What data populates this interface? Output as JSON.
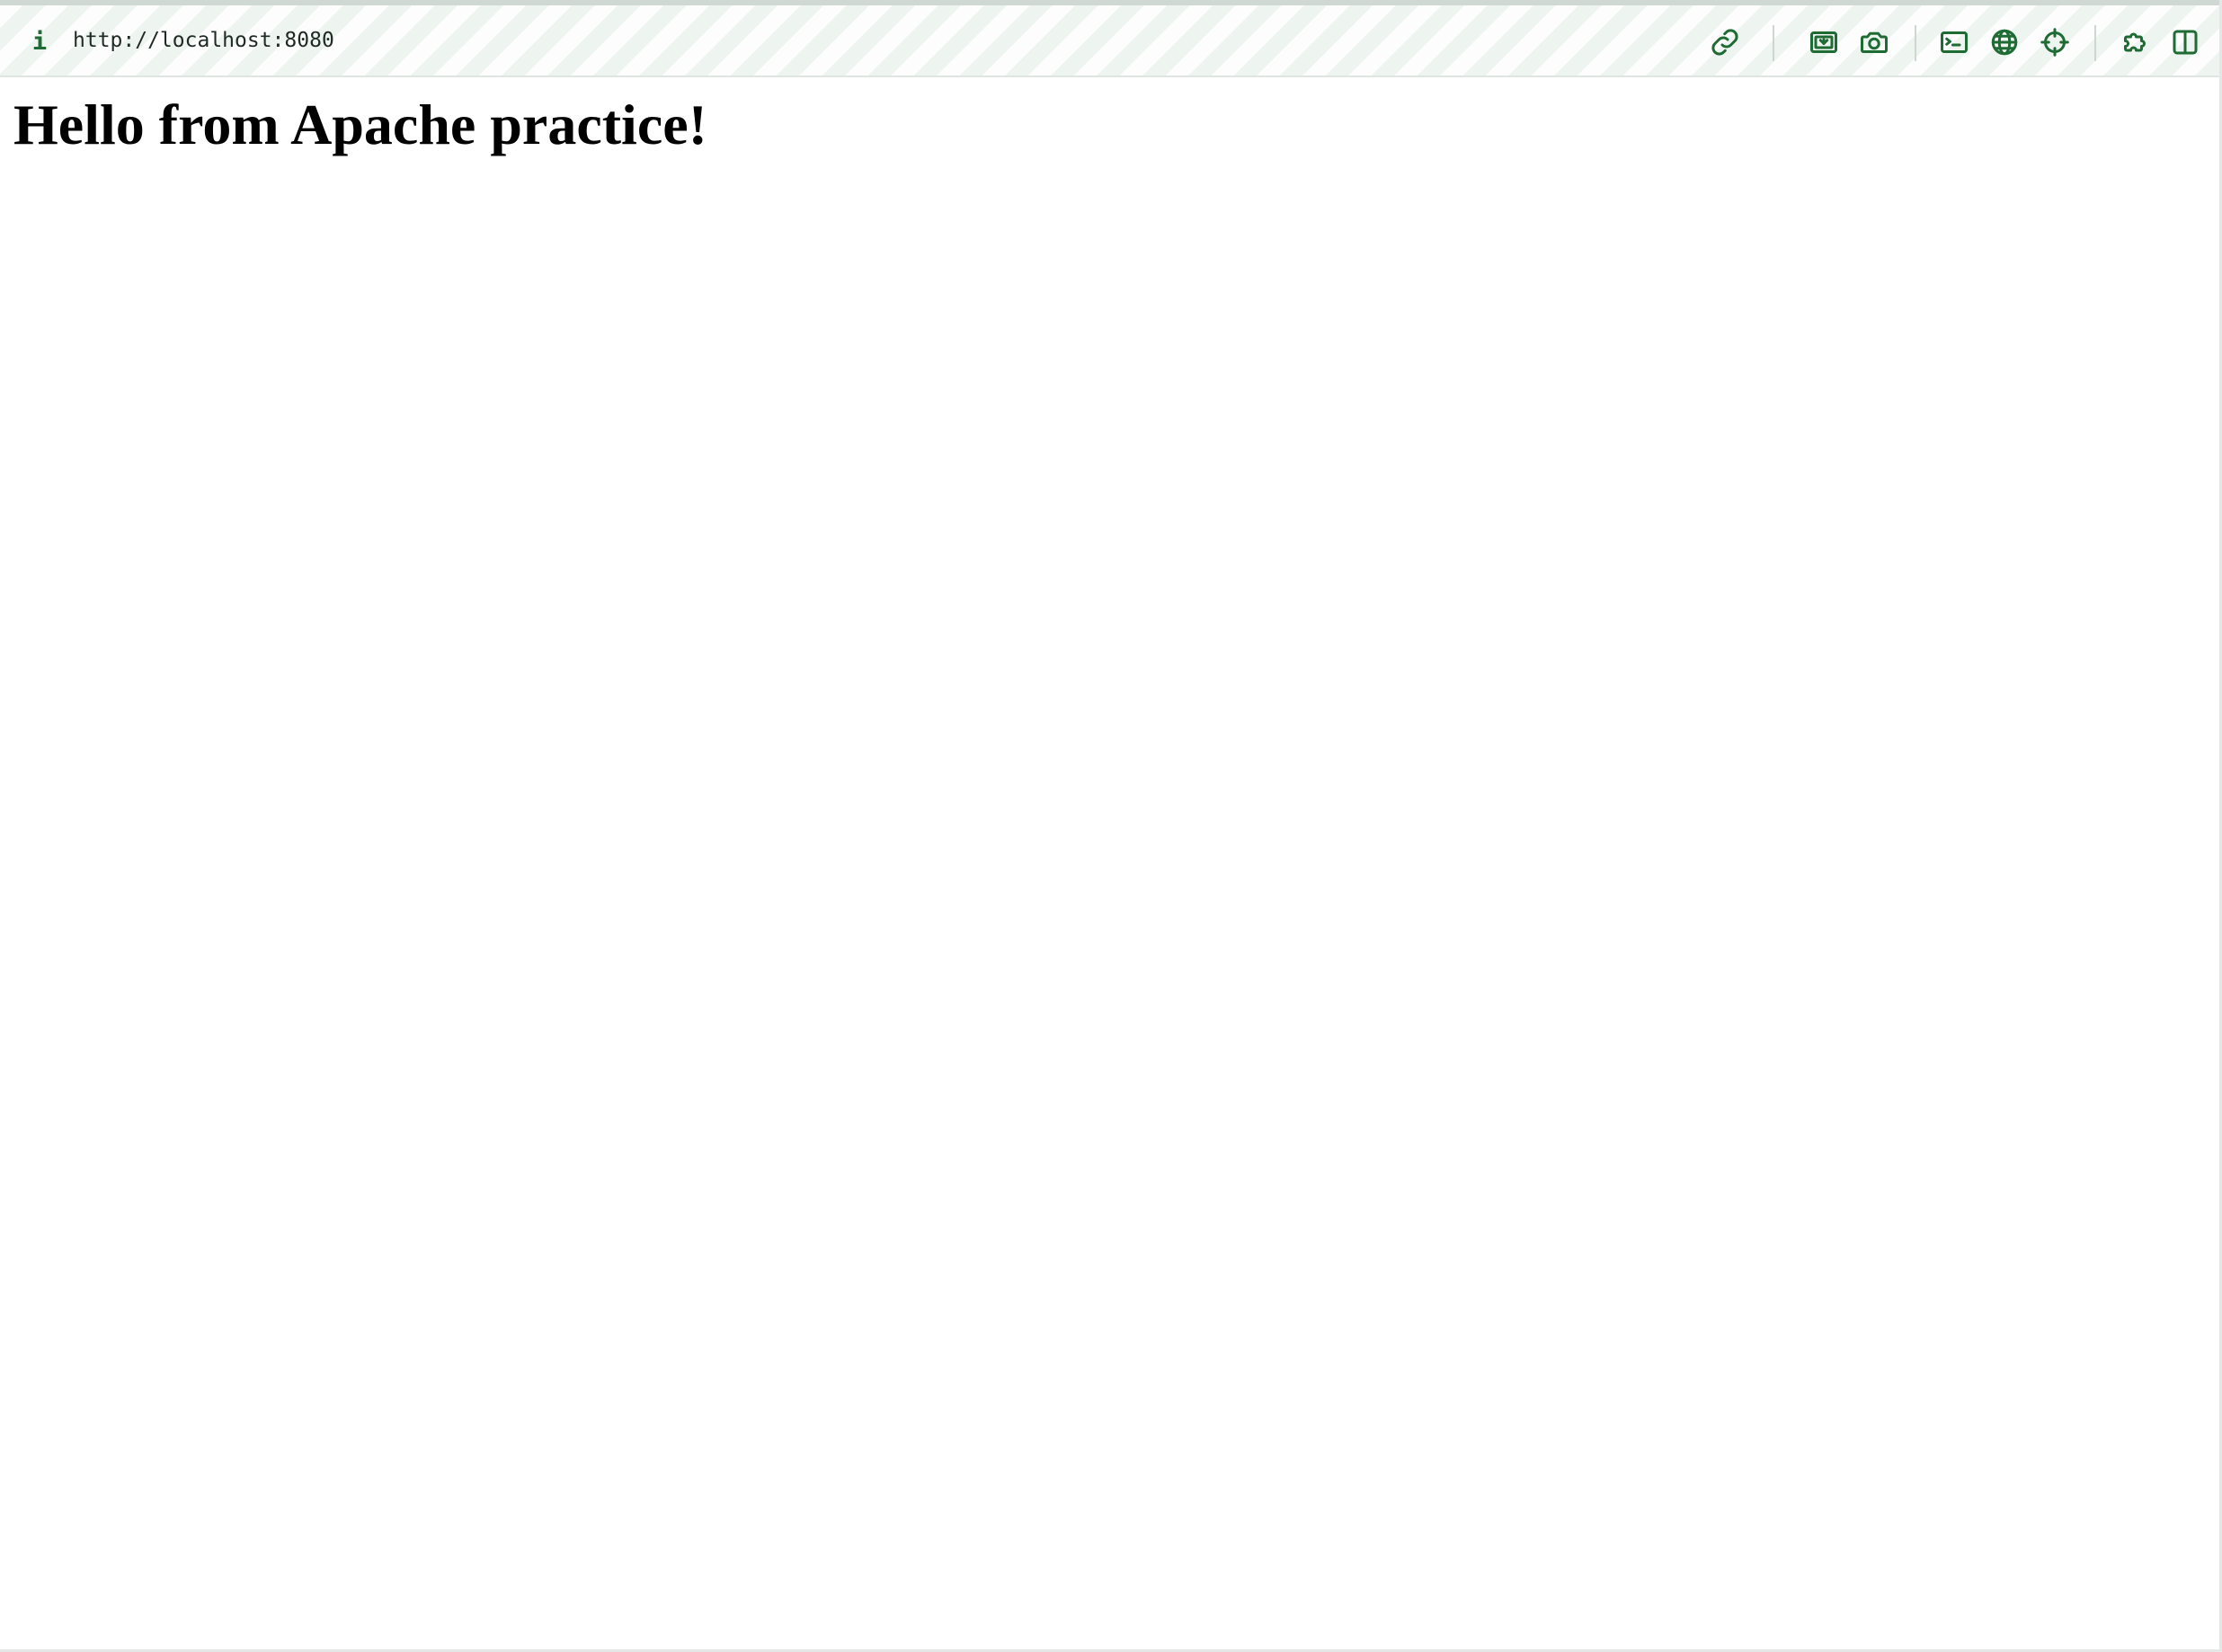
{
  "address_bar": {
    "info_icon": "info-icon",
    "info_glyph": "i",
    "url": "http://localhost:8080"
  },
  "toolbar": {
    "icons": [
      "link-icon",
      "picture-in-picture-icon",
      "camera-icon",
      "terminal-icon",
      "globe-icon",
      "crosshair-icon",
      "extensions-icon",
      "split-view-icon"
    ],
    "accent_color": "#1e6b34"
  },
  "page": {
    "heading": "Hello from Apache practice!"
  }
}
